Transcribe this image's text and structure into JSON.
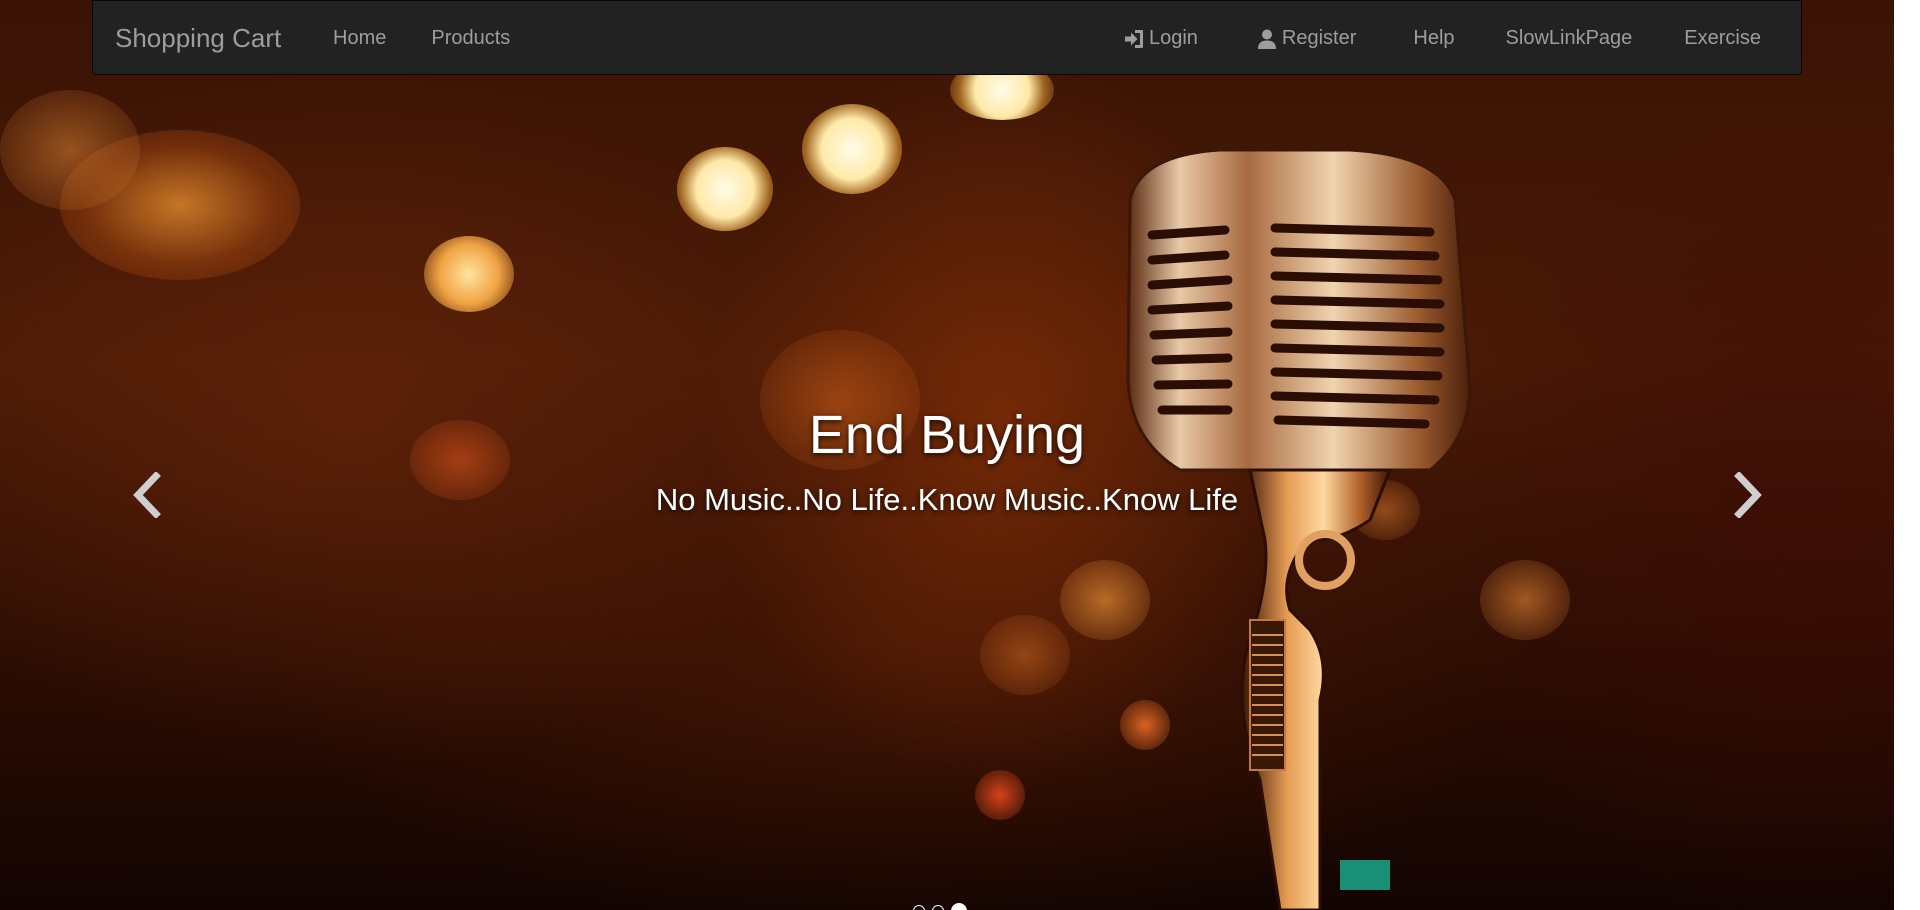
{
  "navbar": {
    "brand": "Shopping Cart",
    "left_items": [
      {
        "label": "Home"
      },
      {
        "label": "Products"
      }
    ],
    "right_items": [
      {
        "label": "Login",
        "icon": "log-in-icon"
      },
      {
        "label": "Register",
        "icon": "user-icon"
      },
      {
        "label": "Help"
      },
      {
        "label": "SlowLinkPage"
      },
      {
        "label": "Exercise"
      }
    ]
  },
  "carousel": {
    "caption_title": "End Buying",
    "caption_subtitle": "No Music..No Life..Know Music..Know Life",
    "prev_icon": "chevron-left-icon",
    "next_icon": "chevron-right-icon",
    "slide_count": 3,
    "active_slide": 3
  },
  "colors": {
    "navbar_bg": "#222222",
    "nav_text": "#9d9d9d",
    "caption_text": "#ffffff"
  }
}
